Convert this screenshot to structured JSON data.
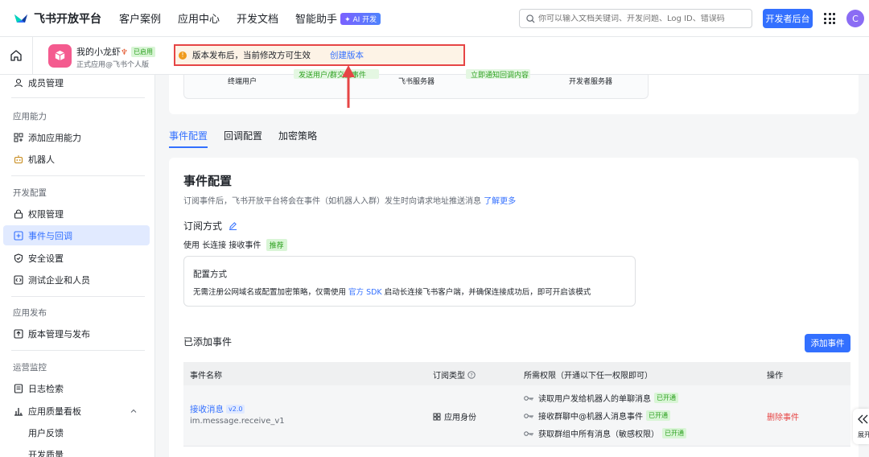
{
  "brand": {
    "title": "飞书开放平台"
  },
  "nav": {
    "items": [
      "客户案例",
      "应用中心",
      "开发文档",
      "智能助手"
    ],
    "ai_badge": "AI 开发"
  },
  "search": {
    "placeholder": "你可以输入文档关键词、开发问题、Log ID、错误码"
  },
  "header_btn": "开发者后台",
  "avatar_letter": "C",
  "app": {
    "name": "我的小龙虾",
    "status": "已启用",
    "subtitle": "正式应用@飞书个人版"
  },
  "notice": {
    "text": "版本发布后，当前修改方可生效",
    "link": "创建版本"
  },
  "sidebar": {
    "top_item": "成员管理",
    "sections": {
      "s1": "应用能力",
      "s2": "开发配置",
      "s3": "应用发布",
      "s4": "运营监控"
    },
    "items": {
      "add_capability": "添加应用能力",
      "bot": "机器人",
      "permissions": "权限管理",
      "events": "事件与回调",
      "security": "安全设置",
      "test_org": "测试企业和人员",
      "versions": "版本管理与发布",
      "logs": "日志检索",
      "quality": "应用质量看板",
      "feedback": "用户反馈",
      "dev_quality": "开发质量"
    }
  },
  "flow": {
    "end_user": "终端用户",
    "feishu_server": "飞书服务器",
    "dev_server": "开发者服务器",
    "chip1": "发送用户/群交互事件",
    "chip2": "立即通知回调内容"
  },
  "tabs": [
    "事件配置",
    "回调配置",
    "加密策略"
  ],
  "event_config": {
    "title": "事件配置",
    "desc": "订阅事件后，飞书开放平台将会在事件（如机器人入群）发生时向请求地址推送消息",
    "learn_more": "了解更多",
    "sub_title": "订阅方式",
    "sub_line_pre": "使用",
    "sub_line_method": "长连接",
    "sub_line_post": "接收事件",
    "recommend": "推荐",
    "cfg_title": "配置方式",
    "cfg_desc_pre": "无需注册公网域名或配置加密策略，仅需使用",
    "cfg_desc_link": "官方 SDK",
    "cfg_desc_post": "启动长连接飞书客户端，并确保连接成功后，即可开启该模式"
  },
  "added": {
    "title": "已添加事件",
    "add_button": "添加事件"
  },
  "table": {
    "headers": {
      "name": "事件名称",
      "type": "订阅类型",
      "perms": "所需权限（开通以下任一权限即可）",
      "ops": "操作"
    },
    "rows": [
      {
        "name": "接收消息",
        "version": "v2.0",
        "id": "im.message.receive_v1",
        "type": "应用身份",
        "perms": [
          {
            "text": "读取用户发给机器人的单聊消息",
            "tag": "已开通"
          },
          {
            "text": "接收群聊中@机器人消息事件",
            "tag": "已开通"
          },
          {
            "text": "获取群组中所有消息（敏感权限）",
            "tag": "已开通"
          }
        ],
        "action": "删除事件"
      }
    ]
  },
  "side_float": {
    "label": "展开"
  }
}
